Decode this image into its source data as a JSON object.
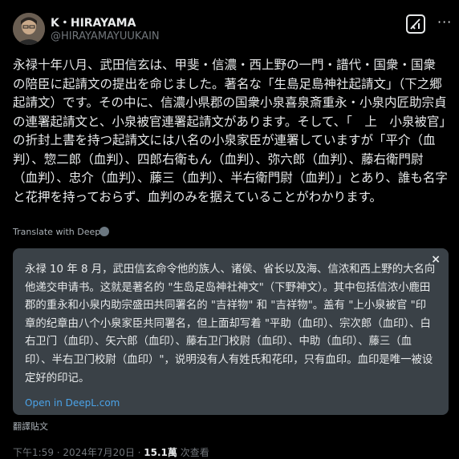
{
  "author": {
    "name": "K・HIRAYAMA",
    "handle": "@HIRAYAMAYUUKAIN"
  },
  "tweet_text": "永禄十年八月、武田信玄は、甲斐・信濃・西上野の一門・譜代・国衆・国衆の陪臣に起請文の提出を命じました。著名な「生島足島神社起請文」（下之郷起請文）です。その中に、信濃小県郡の国衆小泉喜泉斎重永・小泉内匠助宗貞の連署起請文と、小泉被官連署起請文があります。そして、「　上　小泉被官」の折封上書を持つ起請文には八名の小泉家臣が連署していますが「平介（血判）、惣二郎（血判）、四郎右衛もん（血判）、弥六郎（血判）、藤右衛門尉（血判）、忠介（血判）、藤三（血判）、半右衛門尉（血判）」とあり、誰も名字と花押を持っておらず、血判のみを据えていることがわかります。",
  "translate_label": "Translate with DeepL",
  "translation": {
    "text": "永禄 10 年 8 月，武田信玄命令他的族人、诸侯、省长以及海、信浓和西上野的大名向他递交申请书。这就是著名的 \"生岛足岛神社神文\"（下野神文）。其中包括信浓小鹿田郡的重永和小泉内助宗盛田共同署名的 \"吉祥物\" 和 \"吉祥物\"。盖有 \"上小泉被官 \"印章的纪章由八个小泉家臣共同署名，但上面却写着 \"平助（血印）、宗次郎（血印）、白右卫门（血印）、矢六郎（血印）、藤右卫门校尉（血印）、中助（血印）、藤三（血印）、半右卫门校尉（血印）\"，说明没有人有姓氏和花印，只有血印。血印是唯一被设定好的印记。",
    "open_link": "Open in DeepL.com",
    "close": "×"
  },
  "revert_label": "翻譯貼文",
  "meta": {
    "time": "下午1:59 · 2024年7月20日 · ",
    "views_count": "15.1萬",
    "views_label": " 次查看"
  }
}
